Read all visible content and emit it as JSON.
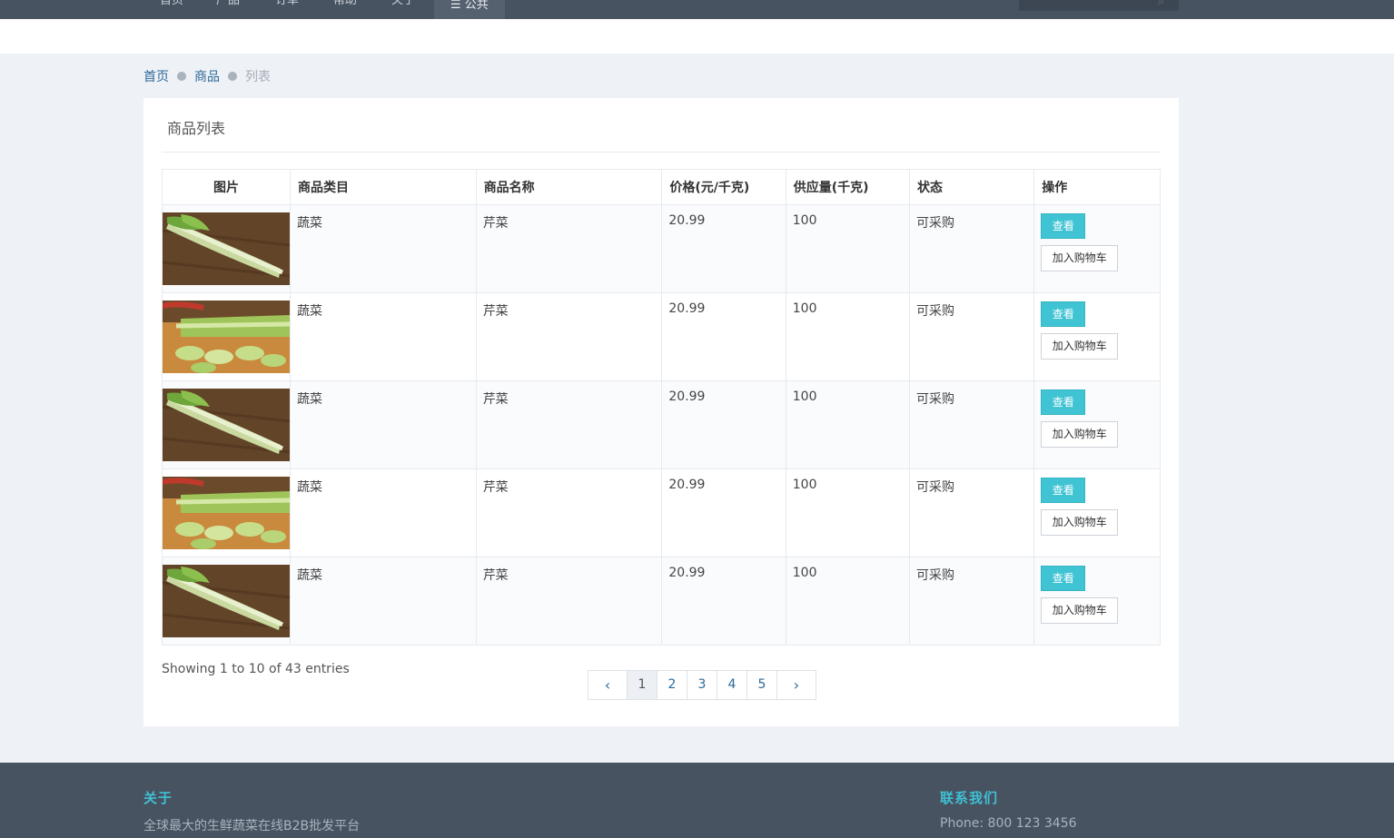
{
  "nav": {
    "items": [
      "首页",
      "产品",
      "订单",
      "帮助",
      "关于"
    ],
    "active_item": "☰ 公共"
  },
  "breadcrumb": {
    "home": "首页",
    "section": "商品",
    "current": "列表"
  },
  "panel": {
    "title": "商品列表"
  },
  "table": {
    "headers": [
      "图片",
      "商品类目",
      "商品名称",
      "价格(元/千克)",
      "供应量(千克)",
      "状态",
      "操作"
    ],
    "rows": [
      {
        "category": "蔬菜",
        "name": "芹菜",
        "price": "20.99",
        "supply": "100",
        "status": "可采购",
        "view_label": "查看",
        "cart_label": "加入购物车"
      },
      {
        "category": "蔬菜",
        "name": "芹菜",
        "price": "20.99",
        "supply": "100",
        "status": "可采购",
        "view_label": "查看",
        "cart_label": "加入购物车"
      },
      {
        "category": "蔬菜",
        "name": "芹菜",
        "price": "20.99",
        "supply": "100",
        "status": "可采购",
        "view_label": "查看",
        "cart_label": "加入购物车"
      },
      {
        "category": "蔬菜",
        "name": "芹菜",
        "price": "20.99",
        "supply": "100",
        "status": "可采购",
        "view_label": "查看",
        "cart_label": "加入购物车"
      },
      {
        "category": "蔬菜",
        "name": "芹菜",
        "price": "20.99",
        "supply": "100",
        "status": "可采购",
        "view_label": "查看",
        "cart_label": "加入购物车"
      }
    ]
  },
  "pagination": {
    "summary": "Showing 1 to 10 of 43 entries",
    "prev": "‹",
    "next": "›",
    "pages": [
      "1",
      "2",
      "3",
      "4",
      "5"
    ],
    "current_page": "1"
  },
  "footer": {
    "about_heading": "关于",
    "about_text": "全球最大的生鲜蔬菜在线B2B批发平台",
    "contact_heading": "联系我们",
    "phone": "Phone: 800 123 3456"
  },
  "colors": {
    "nav_bg": "#485361",
    "accent": "#40c4d4",
    "link": "#2d6a9a",
    "page_bg": "#eef1f6"
  }
}
